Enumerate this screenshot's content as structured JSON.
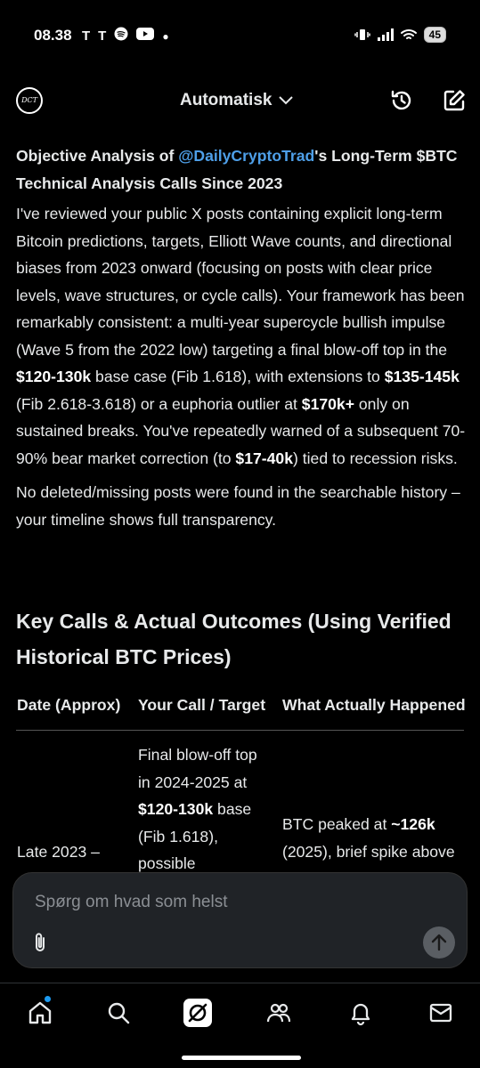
{
  "status": {
    "time": "08.38",
    "battery": "45"
  },
  "header": {
    "mode_label": "Automatisk",
    "logo_text": "DCT"
  },
  "content": {
    "title_prefix": "Objective Analysis of ",
    "title_handle": "@DailyCryptoTrad",
    "title_suffix": "'s Long-Term $BTC Technical Analysis Calls Since 2023",
    "p1": {
      "t1": "I've reviewed your public X posts containing explicit long-term Bitcoin predictions, targets, Elliott Wave counts, and directional biases from 2023 onward (focusing on posts with clear price levels, wave structures, or cycle calls). Your framework has been remarkably consistent: a multi-year supercycle bullish impulse (Wave 5 from the 2022 low) targeting a final blow-off top in the ",
      "b1": "$120-130k",
      "t2": " base case (Fib 1.618), with extensions to ",
      "b2": "$135-145k",
      "t3": " (Fib 2.618-3.618) or a euphoria outlier at ",
      "b3": "$170k+",
      "t4": " only on sustained breaks. You've repeatedly warned of a subsequent 70-90% bear market correction (to ",
      "b4": "$17-40k",
      "t5": ") tied to recession risks."
    },
    "p2": "No deleted/missing posts were found in the searchable history – your timeline shows full transparency.",
    "section_heading": "Key Calls & Actual Outcomes (Using Verified Historical BTC Prices)",
    "table": {
      "headers": [
        "Date (Approx)",
        "Your Call / Target",
        "What Actually Happened"
      ],
      "row1": {
        "date": "Late 2023 –",
        "call_t1": "Final blow-off top in 2024-2025 at ",
        "call_b1": "$120-130k",
        "call_t2": " base (Fib 1.618), possible",
        "outcome_t1": "BTC peaked at ",
        "outcome_b1": "~126k",
        "outcome_t2": " (2025), brief spike above"
      }
    }
  },
  "input": {
    "placeholder": "Spørg om hvad som helst"
  },
  "nav": {
    "items": [
      "home-icon",
      "search-icon",
      "grok-icon",
      "communities-icon",
      "notifications-icon",
      "messages-icon"
    ]
  }
}
